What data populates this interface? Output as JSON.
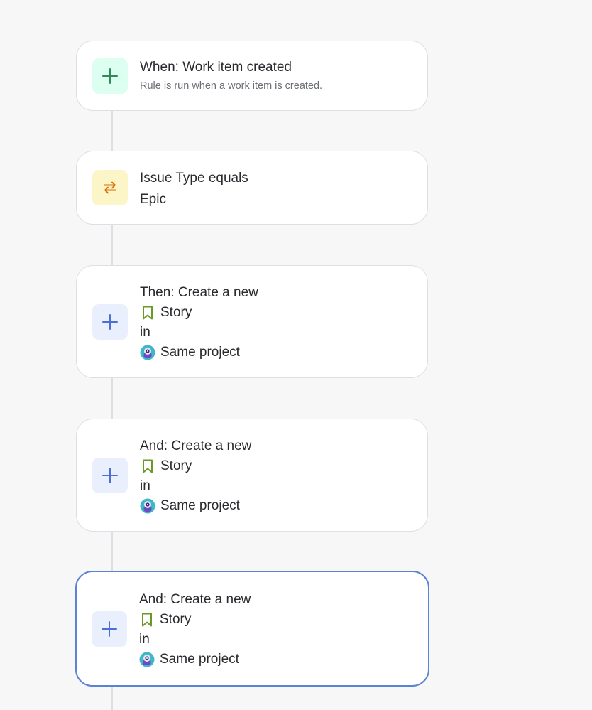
{
  "rule": {
    "trigger": {
      "title": "When: Work item created",
      "subtitle": "Rule is run when a work item is created.",
      "icon": "plus-icon"
    },
    "condition": {
      "title": "Issue Type equals",
      "value": "Epic",
      "icon": "swap-arrows-icon"
    },
    "actions": [
      {
        "title": "Then: Create a new",
        "issue_type": "Story",
        "preposition": "in",
        "project": "Same project",
        "icon": "plus-icon",
        "selected": false
      },
      {
        "title": "And: Create a new",
        "issue_type": "Story",
        "preposition": "in",
        "project": "Same project",
        "icon": "plus-icon",
        "selected": false
      },
      {
        "title": "And: Create a new",
        "issue_type": "Story",
        "preposition": "in",
        "project": "Same project",
        "icon": "plus-icon",
        "selected": true
      }
    ]
  },
  "colors": {
    "background": "#f7f7f7",
    "card_border": "#dcdfe4",
    "selected_border": "#5a82d6",
    "trigger_icon": "#2e8b57",
    "trigger_icon_bg": "#dcfff1",
    "condition_icon": "#d97008",
    "condition_icon_bg": "#fcf5c8",
    "action_icon": "#4c6fd6",
    "action_icon_bg": "#e9effd",
    "story_icon": "#6a9a23"
  }
}
